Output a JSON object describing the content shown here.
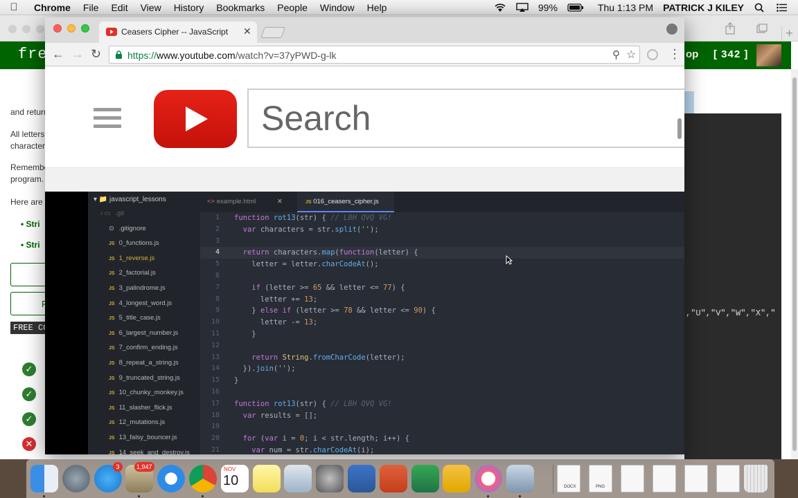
{
  "menubar": {
    "app_name": "Chrome",
    "items": [
      "File",
      "Edit",
      "View",
      "History",
      "Bookmarks",
      "People",
      "Window",
      "Help"
    ],
    "battery": "99%",
    "clock": "Thu 1:13 PM",
    "user": "PATRICK J KILEY"
  },
  "background_window": {
    "logo_text": "free",
    "nav_shop": "op",
    "points": "[ 342 ]",
    "text_lines": [
      "and return",
      "All letters",
      "character",
      "Remember",
      "program.",
      "Here are s"
    ],
    "list_items": [
      "Stri",
      "Stri"
    ],
    "button_partial": "R",
    "tag_text": "FREE CO",
    "editor_snippet": ",\"U\",\"V\",\"W\",\"X\",\""
  },
  "browser": {
    "tab_title": "Ceasers Cipher -- JavaScript",
    "url_scheme": "https://",
    "url_host": "www.youtube.com",
    "url_path": "/watch?v=37yPWD-g-lk"
  },
  "youtube": {
    "search_placeholder": "Search"
  },
  "video": {
    "project_root": "javascript_lessons",
    "files": [
      ".git",
      ".gitignore",
      "0_functions.js",
      "1_reverse.js",
      "2_factorial.js",
      "3_palindrome.js",
      "4_longest_word.js",
      "5_title_case.js",
      "6_largest_number.js",
      "7_confirm_ending.js",
      "8_repeat_a_string.js",
      "9_truncated_string.js",
      "10_chunky_monkey.js",
      "11_slasher_flick.js",
      "12_mutations.js",
      "13_falsy_bouncer.js",
      "14_seek_and_destroy.js"
    ],
    "tabs": [
      "example.html",
      "016_ceasers_cipher.js"
    ],
    "line_numbers": [
      "1",
      "2",
      "3",
      "4",
      "5",
      "6",
      "7",
      "8",
      "9",
      "10",
      "11",
      "12",
      "13",
      "14",
      "15",
      "16",
      "17",
      "18",
      "19",
      "20",
      "21"
    ],
    "current_line_number": "4",
    "code_lines": [
      "function rot13(str) { // LBH QVQ VG!",
      "  var characters = str.split('');",
      "",
      "  return characters.map(function(letter) {",
      "    letter = letter.charCodeAt();",
      "",
      "    if (letter >= 65 && letter <= 77) {",
      "      letter += 13;",
      "    } else if (letter >= 78 && letter <= 90) {",
      "      letter -= 13;",
      "    }",
      "",
      "    return String.fromCharCode(letter);",
      "  }).join('');",
      "}",
      "",
      "function rot13(str) { // LBH QVQ VG!",
      "  var results = [];",
      "",
      "  for (var i = 0; i < str.length; i++) {",
      "    var num = str.charCodeAt(i);"
    ]
  },
  "dock": {
    "apps": [
      "finder-icon",
      "launchpad-icon",
      "app-store-icon",
      "mail-icon",
      "safari-icon",
      "chrome-icon",
      "calendar-icon",
      "notes-icon",
      "preview-icon",
      "system-preferences-icon",
      "word-icon",
      "powerpoint-icon",
      "excel-icon",
      "onenote-icon",
      "itunes-icon",
      "image-capture-icon"
    ],
    "app_store_badge": "3",
    "mail_badge": "1,947",
    "calendar_month": "NOV",
    "calendar_day": "10",
    "doc_labels": [
      "DOCX",
      "PNG"
    ]
  },
  "colors": {
    "fcc_green": "#006400",
    "youtube_red": "#e52d27",
    "editor_bg": "#282c34"
  }
}
